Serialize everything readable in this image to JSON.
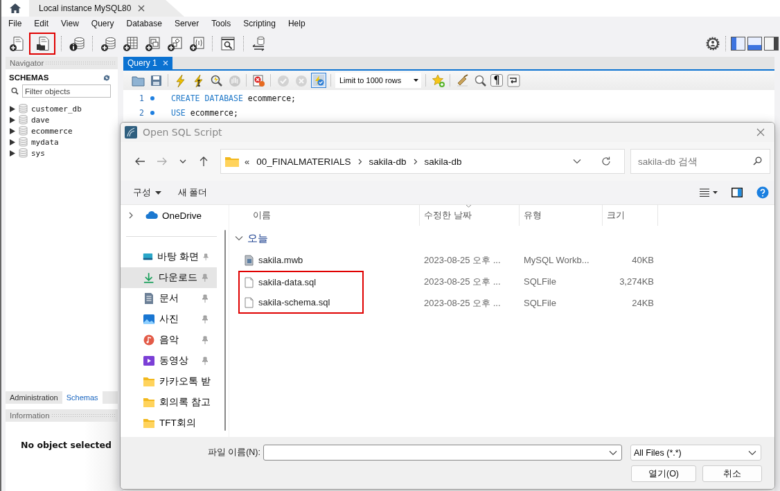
{
  "connection_tab": {
    "title": "Local instance MySQL80",
    "selected": true
  },
  "menu": [
    "File",
    "Edit",
    "View",
    "Query",
    "Database",
    "Server",
    "Tools",
    "Scripting",
    "Help"
  ],
  "main_toolbar": [
    {
      "kind": "sql-new",
      "highlighted": false
    },
    {
      "kind": "sql-open",
      "highlighted": true
    },
    {
      "kind": "separator"
    },
    {
      "kind": "inspector",
      "highlighted": false
    },
    {
      "kind": "separator"
    },
    {
      "kind": "schema-new",
      "highlighted": false
    },
    {
      "kind": "table-new",
      "highlighted": false
    },
    {
      "kind": "view-new",
      "highlighted": false
    },
    {
      "kind": "routine-new",
      "highlighted": false
    },
    {
      "kind": "function-new",
      "highlighted": false
    },
    {
      "kind": "separator"
    },
    {
      "kind": "search-table",
      "highlighted": false
    },
    {
      "kind": "separator"
    },
    {
      "kind": "reconnect",
      "highlighted": false
    }
  ],
  "layout_toggles": [
    {
      "kind": "sidebar",
      "on": true
    },
    {
      "kind": "output",
      "on": true
    },
    {
      "kind": "secondary-sidebar",
      "on": false
    }
  ],
  "navigator": {
    "title": "Navigator",
    "heading": "SCHEMAS",
    "filter": {
      "placeholder": "Filter objects"
    },
    "schemas": [
      {
        "name": "customer_db",
        "expanded": false
      },
      {
        "name": "dave",
        "expanded": false
      },
      {
        "name": "ecommerce",
        "expanded": false
      },
      {
        "name": "mydata",
        "expanded": false
      },
      {
        "name": "sys",
        "expanded": false
      }
    ]
  },
  "panel_tabs": [
    {
      "label": "Administration",
      "selected": false
    },
    {
      "label": "Schemas",
      "selected": true
    }
  ],
  "information": {
    "title": "Information",
    "message": "No object selected"
  },
  "query_tabs": [
    {
      "label": "Query 1",
      "selected": true
    }
  ],
  "editor_toolbar": [
    {
      "kind": "open",
      "disabled": false,
      "on": false
    },
    {
      "kind": "save",
      "disabled": false,
      "on": false
    },
    {
      "kind": "separator"
    },
    {
      "kind": "execute",
      "disabled": false,
      "on": false
    },
    {
      "kind": "execute-current",
      "disabled": false,
      "on": false
    },
    {
      "kind": "explain",
      "disabled": false,
      "on": false
    },
    {
      "kind": "stop",
      "disabled": true,
      "on": false
    },
    {
      "kind": "separator"
    },
    {
      "kind": "toggle-errors",
      "disabled": false,
      "on": false
    },
    {
      "kind": "separator"
    },
    {
      "kind": "commit",
      "disabled": true,
      "on": false
    },
    {
      "kind": "rollback",
      "disabled": true,
      "on": false
    },
    {
      "kind": "autocommit",
      "disabled": false,
      "on": true
    },
    {
      "kind": "separator"
    },
    {
      "kind": "limit",
      "label": "Limit to 1000 rows"
    },
    {
      "kind": "separator"
    },
    {
      "kind": "snippet",
      "disabled": false,
      "on": false
    },
    {
      "kind": "separator"
    },
    {
      "kind": "beautify",
      "disabled": false,
      "on": false
    },
    {
      "kind": "find",
      "disabled": false,
      "on": false
    },
    {
      "kind": "invisibles",
      "label": "¶"
    },
    {
      "kind": "wrap",
      "disabled": false,
      "on": false
    }
  ],
  "editor": {
    "lines": [
      {
        "number": "1",
        "tokens": [
          {
            "kind": "keyword",
            "text": "CREATE DATABASE"
          },
          {
            "kind": "plain",
            "text": " ecommerce;"
          }
        ]
      },
      {
        "number": "2",
        "tokens": [
          {
            "kind": "keyword",
            "text": "USE"
          },
          {
            "kind": "plain",
            "text": " ecommerce;"
          }
        ]
      }
    ]
  },
  "dialog": {
    "title": "Open SQL Script",
    "nav_buttons": [
      {
        "kind": "back",
        "disabled": false
      },
      {
        "kind": "forward",
        "disabled": true
      },
      {
        "kind": "recent",
        "disabled": false
      },
      {
        "kind": "up",
        "disabled": false
      }
    ],
    "path": {
      "overflow": "«",
      "crumbs": [
        "00_FINALMATERIALS",
        "sakila-db",
        "sakila-db"
      ]
    },
    "search": {
      "placeholder": "sakila-db 검색"
    },
    "commands": [
      {
        "label": "구성",
        "dropdown": true
      },
      {
        "label": "새 폴더",
        "dropdown": false
      }
    ],
    "places": [
      {
        "kind": "cloud",
        "label": "OneDrive",
        "expandable": true,
        "pinned": false,
        "selected": false
      },
      {
        "kind": "divider"
      },
      {
        "kind": "desktop",
        "label": "바탕 화면",
        "expandable": false,
        "pinned": true,
        "selected": false
      },
      {
        "kind": "download",
        "label": "다운로드",
        "expandable": false,
        "pinned": true,
        "selected": true
      },
      {
        "kind": "document",
        "label": "문서",
        "expandable": false,
        "pinned": true,
        "selected": false
      },
      {
        "kind": "pictures",
        "label": "사진",
        "expandable": false,
        "pinned": true,
        "selected": false
      },
      {
        "kind": "music",
        "label": "음악",
        "expandable": false,
        "pinned": true,
        "selected": false
      },
      {
        "kind": "video",
        "label": "동영상",
        "expandable": false,
        "pinned": true,
        "selected": false
      },
      {
        "kind": "folder",
        "label": "카카오톡 받",
        "expandable": false,
        "pinned": false,
        "selected": false
      },
      {
        "kind": "folder",
        "label": "회의록 참고",
        "expandable": false,
        "pinned": false,
        "selected": false
      },
      {
        "kind": "folder",
        "label": "TFT회의",
        "expandable": false,
        "pinned": false,
        "selected": false
      }
    ],
    "columns": [
      {
        "label": "이름",
        "sorted": false
      },
      {
        "label": "수정한 날짜",
        "sorted": true
      },
      {
        "label": "유형",
        "sorted": false
      },
      {
        "label": "크기",
        "sorted": false
      }
    ],
    "groups": [
      {
        "label": "오늘",
        "expanded": true,
        "files": [
          {
            "kind": "model",
            "name": "sakila.mwb",
            "modified": "2023-08-25 오후 ...",
            "type": "MySQL Workb...",
            "size": "40KB",
            "highlighted": false
          },
          {
            "kind": "sql",
            "name": "sakila-data.sql",
            "modified": "2023-08-25 오후 ...",
            "type": "SQLFile",
            "size": "3,274KB",
            "highlighted": true
          },
          {
            "kind": "sql",
            "name": "sakila-schema.sql",
            "modified": "2023-08-25 오후 ...",
            "type": "SQLFile",
            "size": "24KB",
            "highlighted": true
          }
        ]
      }
    ],
    "file_name": {
      "label": "파일 이름(N):"
    },
    "filter": {
      "value": "All Files (*.*)"
    },
    "buttons": [
      "열기(O)",
      "취소"
    ]
  }
}
